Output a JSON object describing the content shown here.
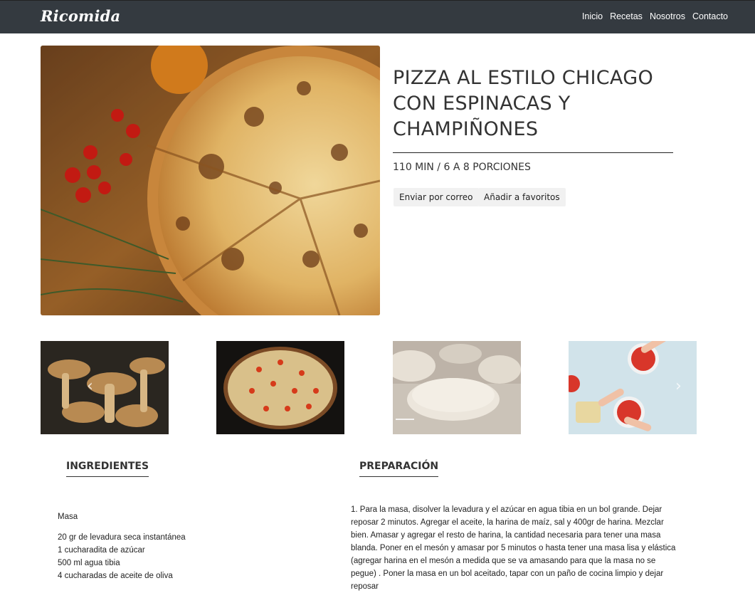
{
  "navbar": {
    "brand": "Ricomida",
    "links": [
      {
        "label": "Inicio"
      },
      {
        "label": "Recetas"
      },
      {
        "label": "Nosotros"
      },
      {
        "label": "Contacto"
      }
    ]
  },
  "recipe": {
    "title": "PIZZA AL ESTILO CHICAGO CON ESPINACAS Y CHAMPIÑONES",
    "meta": "110 MIN / 6 A 8 PORCIONES",
    "actions": {
      "email": "Enviar por correo",
      "favorite": "Añadir a favoritos"
    }
  },
  "carousel": {
    "prev_icon": "chevron-left-icon",
    "next_icon": "chevron-right-icon",
    "prev_glyph": "‹",
    "next_glyph": "›",
    "slides": [
      "mushrooms",
      "pizza",
      "dough",
      "pizza-preparation"
    ]
  },
  "ingredients": {
    "heading": "INGREDIENTES",
    "group_label": "Masa",
    "items": [
      "20 gr de levadura seca instantánea",
      "1 cucharadita de azúcar",
      "500 ml agua tibia",
      "4 cucharadas de aceite de oliva"
    ]
  },
  "preparation": {
    "heading": "PREPARACIÓN",
    "text": "1. Para la masa, disolver la levadura y el azúcar en agua tibia en un bol grande. Dejar reposar 2 minutos. Agregar el aceite, la harina de maíz, sal y 400gr de harina. Mezclar bien. Amasar y agregar el resto de harina, la cantidad necesaria para tener una masa blanda. Poner en el mesón y amasar por 5 minutos o hasta tener una masa lisa y elástica (agregar harina en el mesón a medida que se va amasando para que la masa no se pegue) . Poner la masa en un bol aceitado, tapar con un paño de cocina limpio y dejar reposar"
  },
  "colors": {
    "navbar_bg": "#343a40",
    "text": "#333333",
    "button_bg": "#f1f1f1"
  }
}
